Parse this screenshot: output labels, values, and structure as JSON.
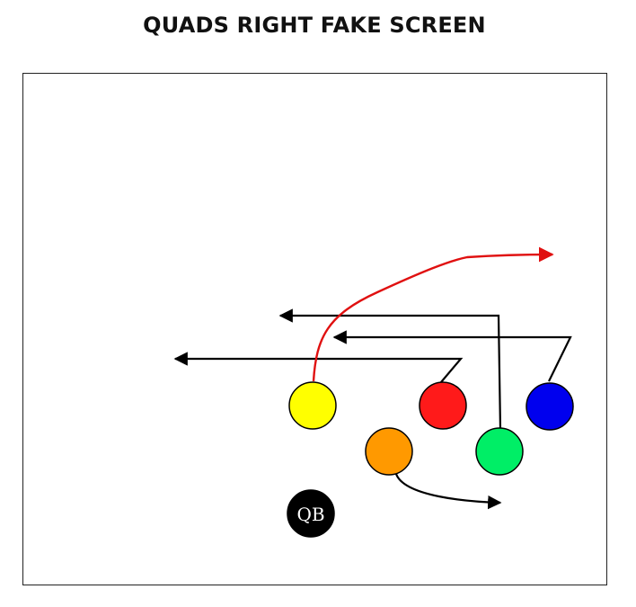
{
  "title": "QUADS RIGHT FAKE SCREEN",
  "qb_label": "QB",
  "colors": {
    "yellow": "#ffff00",
    "red": "#ff1a1a",
    "blue": "#0000ee",
    "green": "#00ee66",
    "orange": "#ff9900",
    "qb": "#000000",
    "route": "#000000",
    "primary_route": "#e01010"
  },
  "players": [
    {
      "id": "yellow",
      "color_key": "yellow"
    },
    {
      "id": "red",
      "color_key": "red"
    },
    {
      "id": "blue",
      "color_key": "blue"
    },
    {
      "id": "green",
      "color_key": "green"
    },
    {
      "id": "orange",
      "color_key": "orange"
    },
    {
      "id": "qb",
      "color_key": "qb"
    }
  ]
}
